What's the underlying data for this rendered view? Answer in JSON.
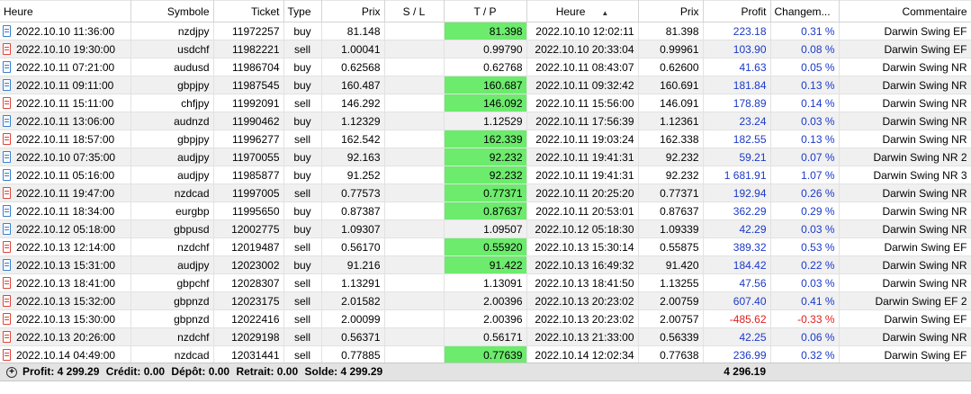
{
  "columns": {
    "heure_open": "Heure",
    "symbole": "Symbole",
    "ticket": "Ticket",
    "type": "Type",
    "prix_open": "Prix",
    "sl": "S / L",
    "tp": "T / P",
    "heure_close": "Heure",
    "prix_close": "Prix",
    "profit": "Profit",
    "change": "Changem...",
    "comment": "Commentaire"
  },
  "rows": [
    {
      "time": "2022.10.10 11:36:00",
      "symbol": "nzdjpy",
      "ticket": "11972257",
      "type": "buy",
      "price": "81.148",
      "sl": "",
      "tp": "81.398",
      "tp_hit": true,
      "close_time": "2022.10.10 12:02:11",
      "close_price": "81.398",
      "profit": "223.18",
      "change": "0.31 %",
      "negative": false,
      "comment": "Darwin Swing EF"
    },
    {
      "time": "2022.10.10 19:30:00",
      "symbol": "usdchf",
      "ticket": "11982221",
      "type": "sell",
      "price": "1.00041",
      "sl": "",
      "tp": "0.99790",
      "tp_hit": false,
      "close_time": "2022.10.10 20:33:04",
      "close_price": "0.99961",
      "profit": "103.90",
      "change": "0.08 %",
      "negative": false,
      "comment": "Darwin Swing EF"
    },
    {
      "time": "2022.10.11 07:21:00",
      "symbol": "audusd",
      "ticket": "11986704",
      "type": "buy",
      "price": "0.62568",
      "sl": "",
      "tp": "0.62768",
      "tp_hit": false,
      "close_time": "2022.10.11 08:43:07",
      "close_price": "0.62600",
      "profit": "41.63",
      "change": "0.05 %",
      "negative": false,
      "comment": "Darwin Swing NR"
    },
    {
      "time": "2022.10.11 09:11:00",
      "symbol": "gbpjpy",
      "ticket": "11987545",
      "type": "buy",
      "price": "160.487",
      "sl": "",
      "tp": "160.687",
      "tp_hit": true,
      "close_time": "2022.10.11 09:32:42",
      "close_price": "160.691",
      "profit": "181.84",
      "change": "0.13 %",
      "negative": false,
      "comment": "Darwin Swing NR"
    },
    {
      "time": "2022.10.11 15:11:00",
      "symbol": "chfjpy",
      "ticket": "11992091",
      "type": "sell",
      "price": "146.292",
      "sl": "",
      "tp": "146.092",
      "tp_hit": true,
      "close_time": "2022.10.11 15:56:00",
      "close_price": "146.091",
      "profit": "178.89",
      "change": "0.14 %",
      "negative": false,
      "comment": "Darwin Swing NR"
    },
    {
      "time": "2022.10.11 13:06:00",
      "symbol": "audnzd",
      "ticket": "11990462",
      "type": "buy",
      "price": "1.12329",
      "sl": "",
      "tp": "1.12529",
      "tp_hit": false,
      "close_time": "2022.10.11 17:56:39",
      "close_price": "1.12361",
      "profit": "23.24",
      "change": "0.03 %",
      "negative": false,
      "comment": "Darwin Swing NR"
    },
    {
      "time": "2022.10.11 18:57:00",
      "symbol": "gbpjpy",
      "ticket": "11996277",
      "type": "sell",
      "price": "162.542",
      "sl": "",
      "tp": "162.339",
      "tp_hit": true,
      "close_time": "2022.10.11 19:03:24",
      "close_price": "162.338",
      "profit": "182.55",
      "change": "0.13 %",
      "negative": false,
      "comment": "Darwin Swing NR"
    },
    {
      "time": "2022.10.10 07:35:00",
      "symbol": "audjpy",
      "ticket": "11970055",
      "type": "buy",
      "price": "92.163",
      "sl": "",
      "tp": "92.232",
      "tp_hit": true,
      "close_time": "2022.10.11 19:41:31",
      "close_price": "92.232",
      "profit": "59.21",
      "change": "0.07 %",
      "negative": false,
      "comment": "Darwin Swing NR 2"
    },
    {
      "time": "2022.10.11 05:16:00",
      "symbol": "audjpy",
      "ticket": "11985877",
      "type": "buy",
      "price": "91.252",
      "sl": "",
      "tp": "92.232",
      "tp_hit": true,
      "close_time": "2022.10.11 19:41:31",
      "close_price": "92.232",
      "profit": "1 681.91",
      "change": "1.07 %",
      "negative": false,
      "comment": "Darwin Swing NR 3"
    },
    {
      "time": "2022.10.11 19:47:00",
      "symbol": "nzdcad",
      "ticket": "11997005",
      "type": "sell",
      "price": "0.77573",
      "sl": "",
      "tp": "0.77371",
      "tp_hit": true,
      "close_time": "2022.10.11 20:25:20",
      "close_price": "0.77371",
      "profit": "192.94",
      "change": "0.26 %",
      "negative": false,
      "comment": "Darwin Swing NR"
    },
    {
      "time": "2022.10.11 18:34:00",
      "symbol": "eurgbp",
      "ticket": "11995650",
      "type": "buy",
      "price": "0.87387",
      "sl": "",
      "tp": "0.87637",
      "tp_hit": true,
      "close_time": "2022.10.11 20:53:01",
      "close_price": "0.87637",
      "profit": "362.29",
      "change": "0.29 %",
      "negative": false,
      "comment": "Darwin Swing NR"
    },
    {
      "time": "2022.10.12 05:18:00",
      "symbol": "gbpusd",
      "ticket": "12002775",
      "type": "buy",
      "price": "1.09307",
      "sl": "",
      "tp": "1.09507",
      "tp_hit": false,
      "close_time": "2022.10.12 05:18:30",
      "close_price": "1.09339",
      "profit": "42.29",
      "change": "0.03 %",
      "negative": false,
      "comment": "Darwin Swing NR"
    },
    {
      "time": "2022.10.13 12:14:00",
      "symbol": "nzdchf",
      "ticket": "12019487",
      "type": "sell",
      "price": "0.56170",
      "sl": "",
      "tp": "0.55920",
      "tp_hit": true,
      "close_time": "2022.10.13 15:30:14",
      "close_price": "0.55875",
      "profit": "389.32",
      "change": "0.53 %",
      "negative": false,
      "comment": "Darwin Swing EF"
    },
    {
      "time": "2022.10.13 15:31:00",
      "symbol": "audjpy",
      "ticket": "12023002",
      "type": "buy",
      "price": "91.216",
      "sl": "",
      "tp": "91.422",
      "tp_hit": true,
      "close_time": "2022.10.13 16:49:32",
      "close_price": "91.420",
      "profit": "184.42",
      "change": "0.22 %",
      "negative": false,
      "comment": "Darwin Swing NR"
    },
    {
      "time": "2022.10.13 18:41:00",
      "symbol": "gbpchf",
      "ticket": "12028307",
      "type": "sell",
      "price": "1.13291",
      "sl": "",
      "tp": "1.13091",
      "tp_hit": false,
      "close_time": "2022.10.13 18:41:50",
      "close_price": "1.13255",
      "profit": "47.56",
      "change": "0.03 %",
      "negative": false,
      "comment": "Darwin Swing NR"
    },
    {
      "time": "2022.10.13 15:32:00",
      "symbol": "gbpnzd",
      "ticket": "12023175",
      "type": "sell",
      "price": "2.01582",
      "sl": "",
      "tp": "2.00396",
      "tp_hit": false,
      "close_time": "2022.10.13 20:23:02",
      "close_price": "2.00759",
      "profit": "607.40",
      "change": "0.41 %",
      "negative": false,
      "comment": "Darwin Swing EF 2"
    },
    {
      "time": "2022.10.13 15:30:00",
      "symbol": "gbpnzd",
      "ticket": "12022416",
      "type": "sell",
      "price": "2.00099",
      "sl": "",
      "tp": "2.00396",
      "tp_hit": false,
      "close_time": "2022.10.13 20:23:02",
      "close_price": "2.00757",
      "profit": "-485.62",
      "change": "-0.33 %",
      "negative": true,
      "comment": "Darwin Swing EF"
    },
    {
      "time": "2022.10.13 20:26:00",
      "symbol": "nzdchf",
      "ticket": "12029198",
      "type": "sell",
      "price": "0.56371",
      "sl": "",
      "tp": "0.56171",
      "tp_hit": false,
      "close_time": "2022.10.13 21:33:00",
      "close_price": "0.56339",
      "profit": "42.25",
      "change": "0.06 %",
      "negative": false,
      "comment": "Darwin Swing NR"
    },
    {
      "time": "2022.10.14 04:49:00",
      "symbol": "nzdcad",
      "ticket": "12031441",
      "type": "sell",
      "price": "0.77885",
      "sl": "",
      "tp": "0.77639",
      "tp_hit": true,
      "close_time": "2022.10.14 12:02:34",
      "close_price": "0.77638",
      "profit": "236.99",
      "change": "0.32 %",
      "negative": false,
      "comment": "Darwin Swing EF"
    }
  ],
  "footer": {
    "profit": "Profit: 4 299.29",
    "credit": "Crédit: 0.00",
    "deposit": "Dépôt: 0.00",
    "withdrawal": "Retrait: 0.00",
    "balance": "Solde: 4 299.29",
    "total": "4 296.19"
  },
  "colors": {
    "tp_hit": "#6ceb6c",
    "positive": "#1c39c8",
    "negative": "#e02020",
    "alt_row": "#f0f0f0"
  }
}
